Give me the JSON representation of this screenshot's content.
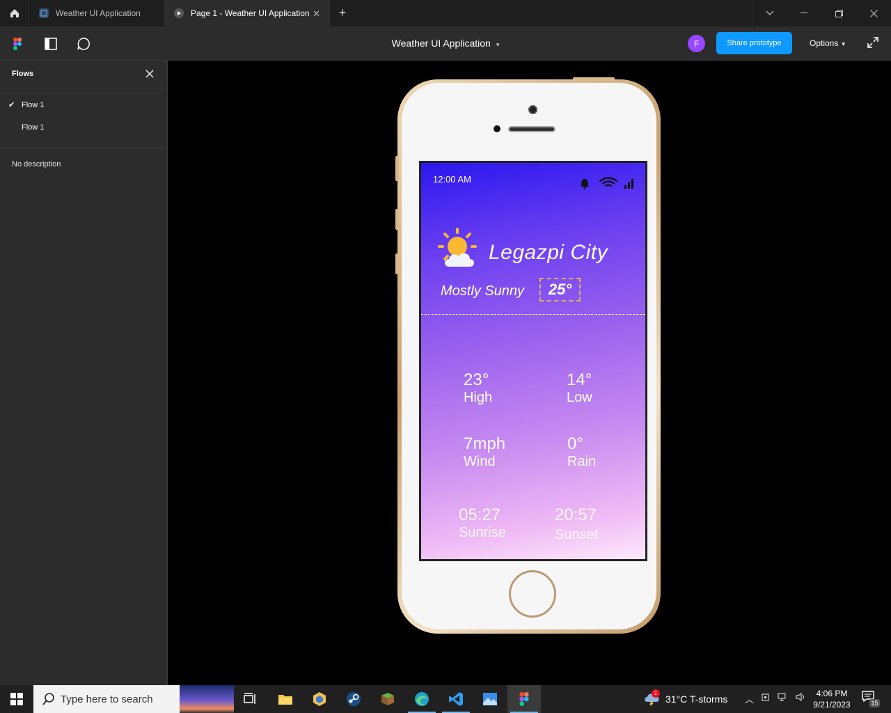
{
  "titlebar": {
    "tabs": [
      {
        "label": "Weather UI Application"
      },
      {
        "label": "Page 1 - Weather UI Application"
      }
    ]
  },
  "toolbar": {
    "project_title": "Weather UI Application",
    "avatar_initial": "F",
    "share_label": "Share prototype",
    "options_label": "Options"
  },
  "sidebar": {
    "title": "Flows",
    "flows": [
      {
        "label": "Flow 1",
        "selected": true
      },
      {
        "label": "Flow 1",
        "selected": false
      }
    ],
    "description": "No description"
  },
  "phone": {
    "status_time": "12:00 AM",
    "city": "Legazpi City",
    "condition": "Mostly Sunny",
    "current_temp": "25°",
    "stats": {
      "high": {
        "value": "23°",
        "label": "High"
      },
      "low": {
        "value": "14°",
        "label": "Low"
      },
      "wind": {
        "value": "7mph",
        "label": "Wind"
      },
      "rain": {
        "value": "0°",
        "label": "Rain"
      },
      "sunrise": {
        "value": "05:27",
        "label": "Sunrise"
      },
      "sunset": {
        "value": "20:57",
        "label": "Sunset"
      }
    },
    "colors": {
      "gradient_top": "#2b17ef",
      "gradient_bottom": "#fde9fb",
      "temp_border": "#e0b25a"
    }
  },
  "taskbar": {
    "search_placeholder": "Type here to search",
    "weather": "31°C  T-storms",
    "weather_badge": "1",
    "time": "4:06 PM",
    "date": "9/21/2023",
    "notification_count": "15"
  },
  "colors": {
    "accent": "#0d99ff",
    "avatar": "#9747ff",
    "panel": "#2c2c2c",
    "titlebar": "#1e1e1e"
  }
}
